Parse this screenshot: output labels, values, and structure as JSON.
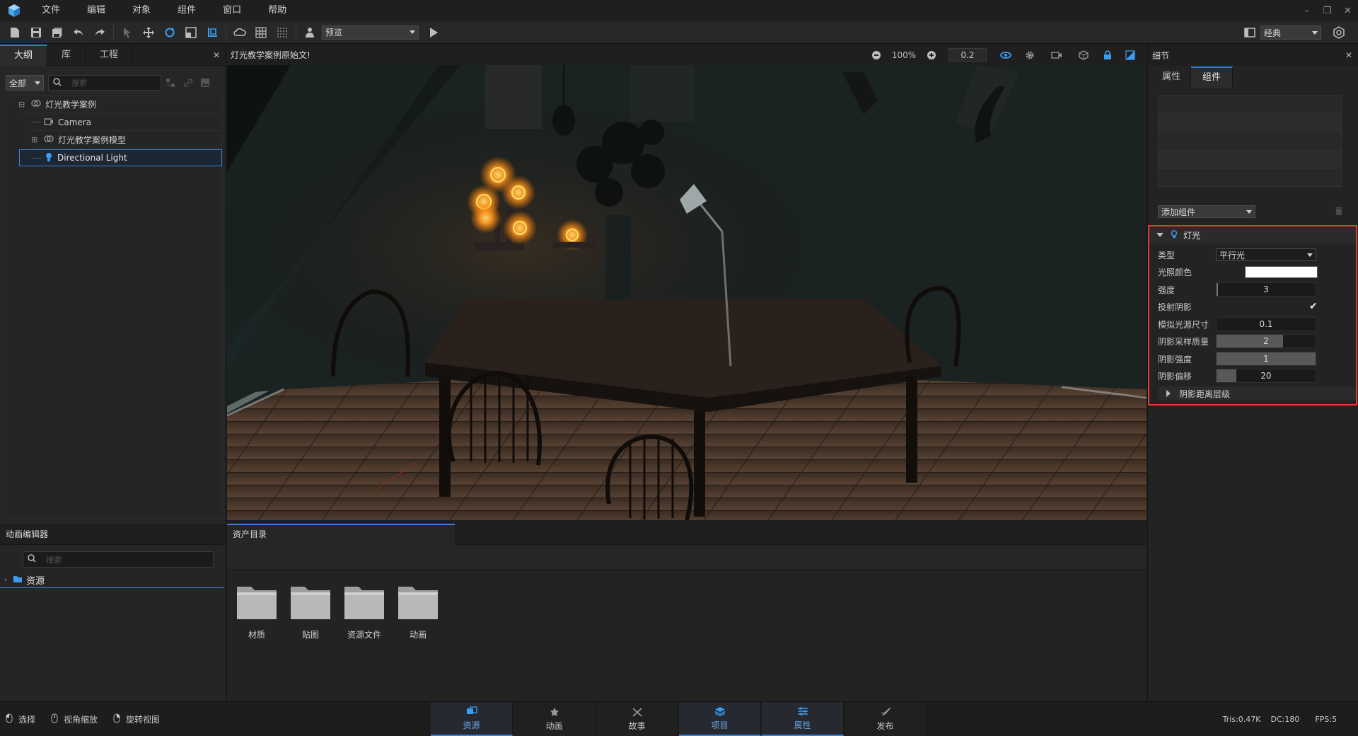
{
  "menubar": {
    "items": [
      "文件",
      "编辑",
      "对象",
      "组件",
      "窗口",
      "帮助"
    ]
  },
  "toolbar": {
    "mode_select": "预览",
    "layout_select": "经典"
  },
  "outline": {
    "tabs": [
      "大纲",
      "库",
      "工程"
    ],
    "filter": "全部",
    "search_placeholder": "搜索",
    "tree": [
      {
        "label": "灯光教学案例",
        "icon": "group-icon",
        "expander": "⊟"
      },
      {
        "label": "Camera",
        "icon": "camera-icon",
        "expander": ""
      },
      {
        "label": "灯光教学案例模型",
        "icon": "group-icon",
        "expander": "⊞"
      },
      {
        "label": "Directional Light",
        "icon": "light-icon",
        "expander": ""
      }
    ]
  },
  "viewport": {
    "title": "灯光教学案例原始文!",
    "zoom": "100%",
    "step": "0.2"
  },
  "details": {
    "title": "细节",
    "tabs": [
      "属性",
      "组件"
    ],
    "add_component": "添加组件",
    "section_title": "灯光",
    "props": {
      "type_label": "类型",
      "type_value": "平行光",
      "color_label": "光照颜色",
      "color_value": "#ffffff",
      "intensity_label": "强度",
      "intensity_value": "3",
      "cast_shadow_label": "投射阴影",
      "cast_shadow_checked": true,
      "source_size_label": "模拟光源尺寸",
      "source_size_value": "0.1",
      "shadow_quality_label": "阴影采样质量",
      "shadow_quality_value": "2",
      "shadow_quality_fill": 0.67,
      "shadow_strength_label": "阴影强度",
      "shadow_strength_value": "1",
      "shadow_strength_fill": 1.0,
      "shadow_bias_label": "阴影偏移",
      "shadow_bias_value": "20",
      "shadow_bias_fill": 0.2,
      "cascade_label": "阴影距离层级"
    },
    "highlight_color": "#e53935"
  },
  "anim_panel": {
    "title": "动画编辑器",
    "search_placeholder": "搜索",
    "root_label": "资源"
  },
  "assets": {
    "title": "资产目录",
    "folders": [
      "材质",
      "贴图",
      "资源文件",
      "动画"
    ]
  },
  "statusbar": {
    "left": [
      {
        "label": "选择",
        "icon": "mouse-left-icon"
      },
      {
        "label": "视角缩放",
        "icon": "mouse-wheel-icon"
      },
      {
        "label": "旋转视图",
        "icon": "mouse-right-icon"
      }
    ],
    "tabs": [
      {
        "label": "资源",
        "icon": "resource-icon",
        "active": true
      },
      {
        "label": "动画",
        "icon": "animation-icon",
        "active": false
      },
      {
        "label": "故事",
        "icon": "story-icon",
        "active": false
      },
      {
        "label": "项目",
        "icon": "project-icon",
        "active": true
      },
      {
        "label": "属性",
        "icon": "properties-icon",
        "active": true
      },
      {
        "label": "发布",
        "icon": "publish-icon",
        "active": false
      }
    ],
    "tris": "Tris:0.47K",
    "dc": "DC:180",
    "fps": "FPS:5"
  },
  "colors": {
    "accent": "#3b82d4",
    "panel": "#262626",
    "lamp_glow": "#ffb020"
  }
}
